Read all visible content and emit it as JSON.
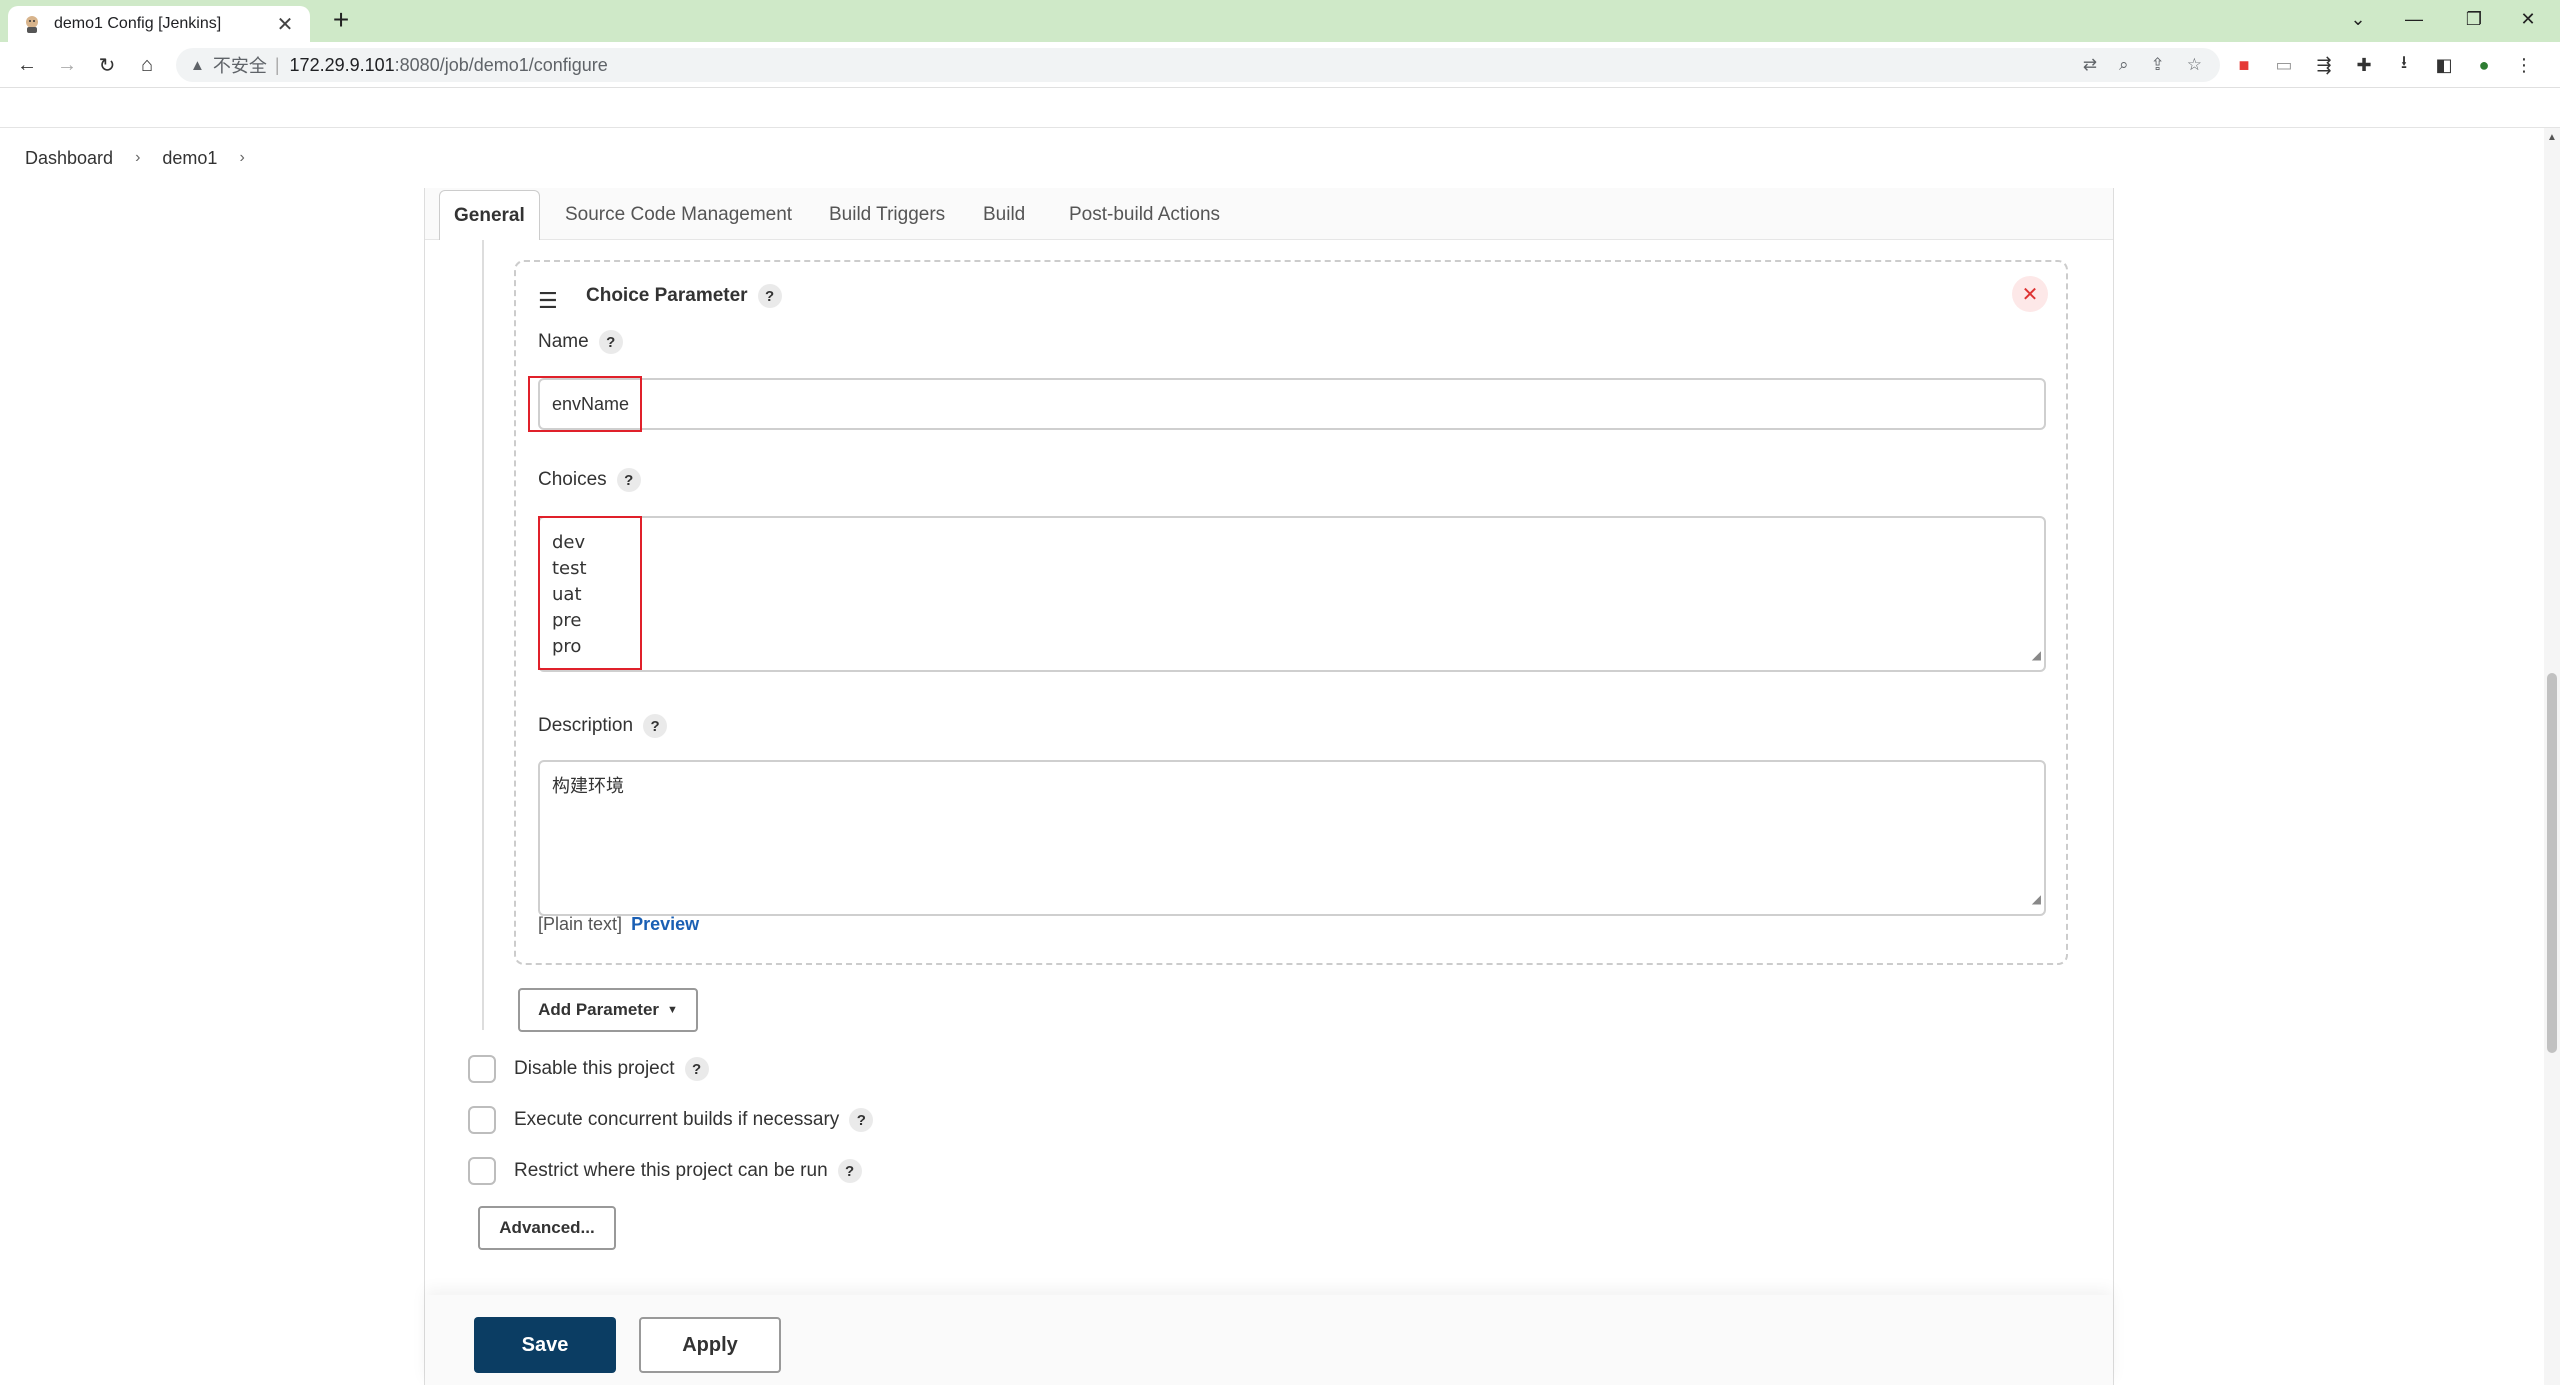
{
  "browser": {
    "tab_title": "demo1 Config [Jenkins]",
    "new_tab_symbol": "+",
    "address": {
      "security_label": "不安全",
      "separator": "|",
      "host": "172.29.9.101",
      "path": ":8080/job/demo1/configure"
    }
  },
  "breadcrumb": {
    "items": [
      "Dashboard",
      "demo1"
    ],
    "separator": "›"
  },
  "tabs": [
    "General",
    "Source Code Management",
    "Build Triggers",
    "Build",
    "Post-build Actions"
  ],
  "choice_parameter": {
    "title": "Choice Parameter",
    "name_label": "Name",
    "name_value": "envName",
    "choices_label": "Choices",
    "choices": [
      "dev",
      "test",
      "uat",
      "pre",
      "pro"
    ],
    "description_label": "Description",
    "description_value": "构建环境",
    "plain_text_label": "[Plain text]",
    "preview_label": "Preview"
  },
  "help_symbol": "?",
  "add_parameter_label": "Add Parameter",
  "options": [
    {
      "label": "Disable this project",
      "checked": false
    },
    {
      "label": "Execute concurrent builds if necessary",
      "checked": false
    },
    {
      "label": "Restrict where this project can be run",
      "checked": false
    }
  ],
  "advanced_label": "Advanced...",
  "save_label": "Save",
  "apply_label": "Apply",
  "colors": {
    "tabbar": "#cfe9c8",
    "save_button": "#0b3d63",
    "highlight": "#e0202a",
    "link": "#1a5fb4"
  }
}
